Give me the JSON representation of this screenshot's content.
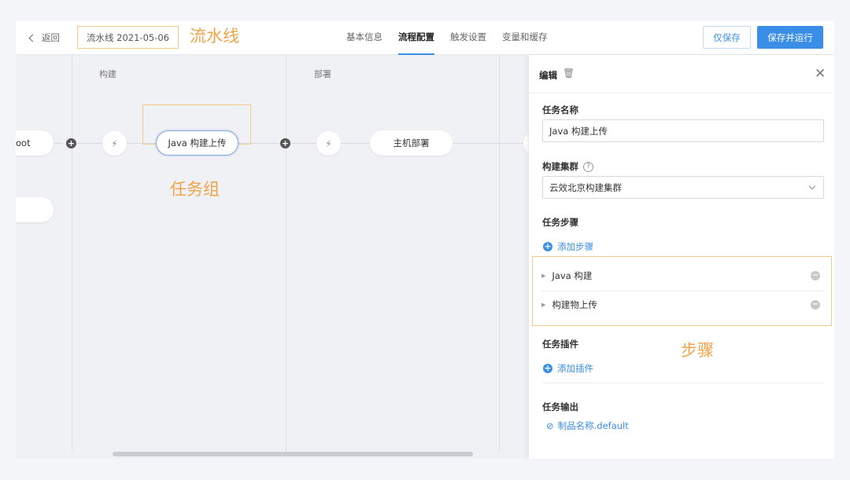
{
  "header": {
    "back_label": "返回",
    "pipeline_name": "流水线 2021-05-06",
    "annotation": "流水线",
    "tabs": [
      {
        "label": "基本信息",
        "active": false
      },
      {
        "label": "流程配置",
        "active": true
      },
      {
        "label": "触发设置",
        "active": false
      },
      {
        "label": "变量和缓存",
        "active": false
      }
    ],
    "save_label": "仅保存",
    "save_run_label": "保存并运行"
  },
  "canvas": {
    "stages": [
      {
        "title": "构建"
      },
      {
        "title": "部署"
      }
    ],
    "partial_node_1": "oot",
    "job_build": "Java 构建上传",
    "job_deploy": "主机部署",
    "annotation_task_group": "任务组",
    "bolt_icon": "⚡"
  },
  "panel": {
    "title": "编辑",
    "task_name_label": "任务名称",
    "task_name_value": "Java 构建上传",
    "cluster_label": "构建集群",
    "cluster_value": "云效北京构建集群",
    "steps_label": "任务步骤",
    "add_step": "添加步骤",
    "steps": [
      {
        "label": "Java 构建"
      },
      {
        "label": "构建物上传"
      }
    ],
    "annotation_steps": "步骤",
    "plugins_label": "任务插件",
    "add_plugin": "添加插件",
    "output_label": "任务输出",
    "output_value": "制品名称.default"
  },
  "colors": {
    "accent": "#3a8ee6",
    "annotation": "#f0a44a"
  }
}
